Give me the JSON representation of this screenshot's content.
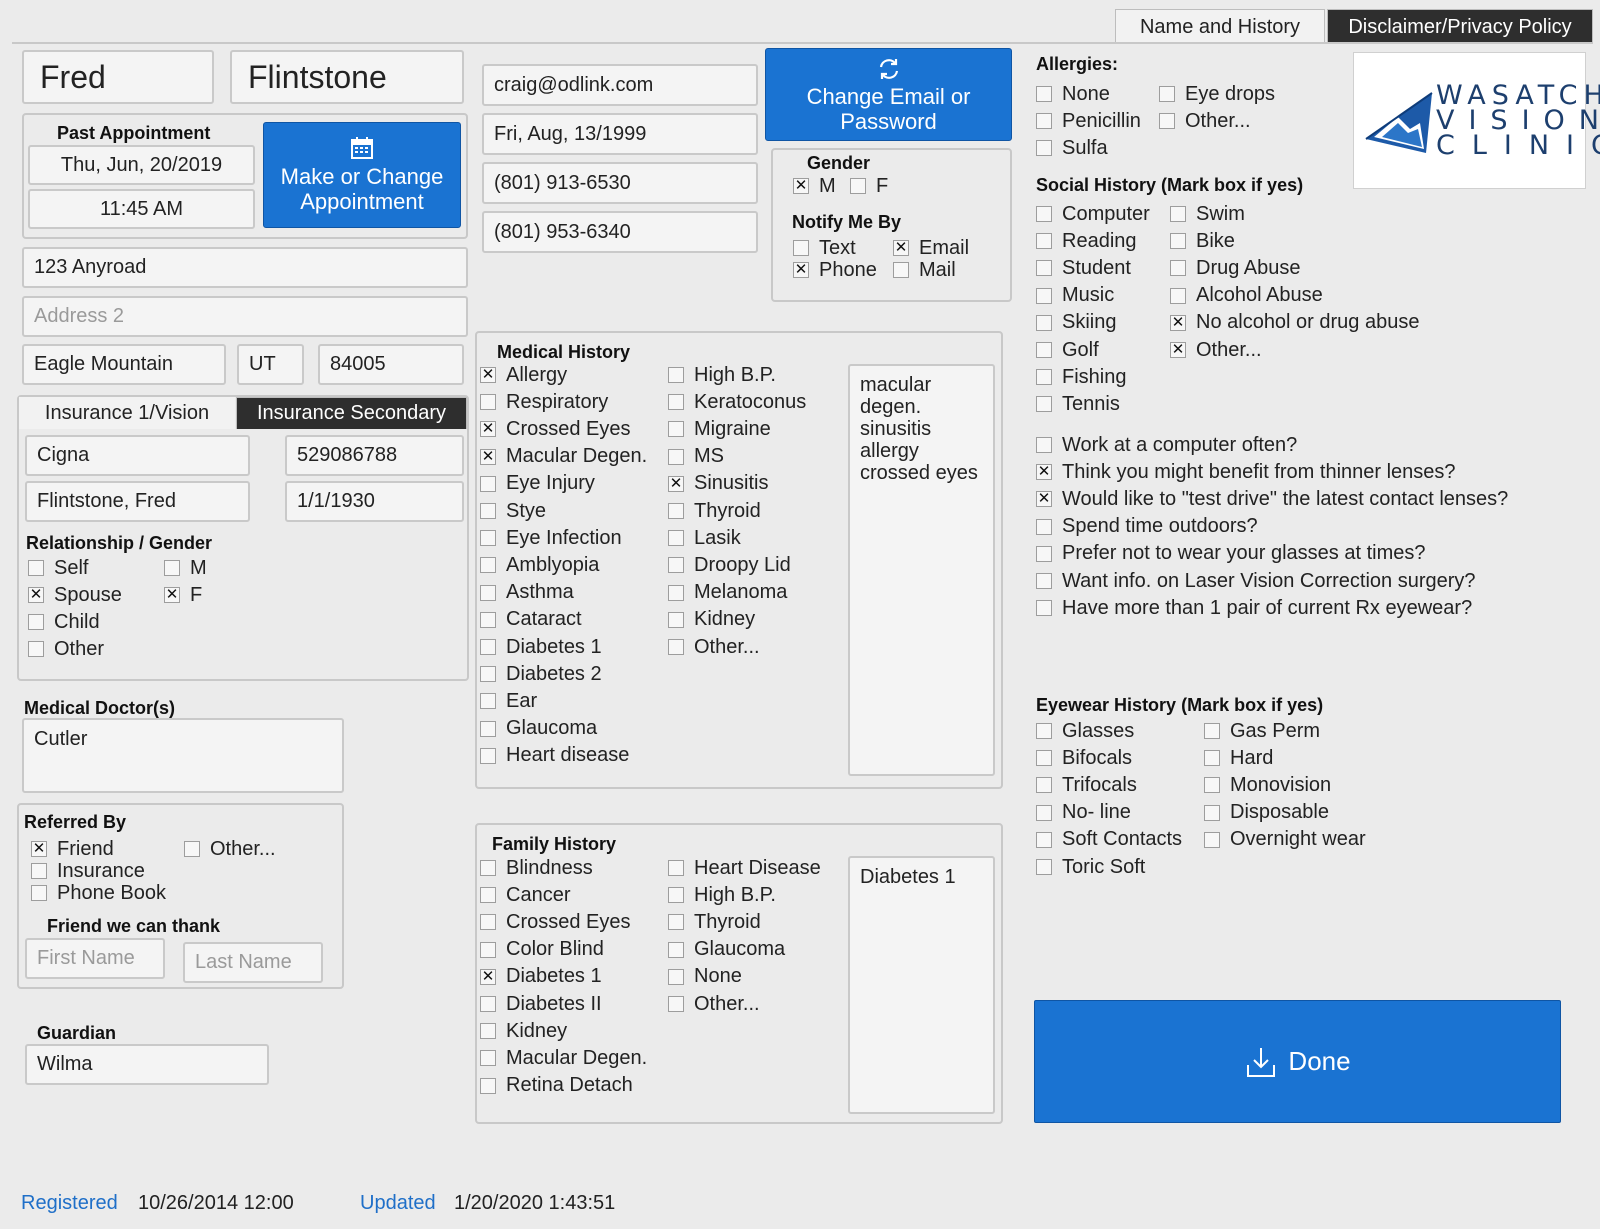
{
  "tabs": {
    "name_history": "Name and History",
    "disclaimer": "Disclaimer/Privacy Policy"
  },
  "patient": {
    "first_name": "Fred",
    "last_name": "Flintstone",
    "email": "craig@odlink.com",
    "dob": "Fri, Aug, 13/1999",
    "phone1": "(801) 913-6530",
    "phone2": "(801) 953-6340",
    "address1": "123 Anyroad",
    "address2_placeholder": "Address 2",
    "city": "Eagle Mountain",
    "state": "UT",
    "zip": "84005"
  },
  "appointment": {
    "title": "Past Appointment",
    "date": "Thu, Jun, 20/2019",
    "time": "11:45 AM",
    "button": "Make or Change Appointment",
    "icon": "calendar-icon"
  },
  "account_button": {
    "label": "Change Email or Password",
    "icon": "refresh-icon"
  },
  "gender": {
    "title": "Gender",
    "options": [
      {
        "label": "M",
        "checked": true
      },
      {
        "label": "F",
        "checked": false
      }
    ]
  },
  "notify": {
    "title": "Notify Me By",
    "options": [
      {
        "label": "Text",
        "checked": false
      },
      {
        "label": "Email",
        "checked": true
      },
      {
        "label": "Phone",
        "checked": true
      },
      {
        "label": "Mail",
        "checked": false
      }
    ]
  },
  "insurance": {
    "tab_primary": "Insurance 1/Vision",
    "tab_secondary": "Insurance Secondary",
    "carrier": "Cigna",
    "member_id": "529086788",
    "subscriber": "Flintstone, Fred",
    "sub_dob": "1/1/1930",
    "rel_title": "Relationship / Gender",
    "relationship": [
      {
        "label": "Self",
        "checked": false
      },
      {
        "label": "Spouse",
        "checked": true
      },
      {
        "label": "Child",
        "checked": false
      },
      {
        "label": "Other",
        "checked": false
      }
    ],
    "gender": [
      {
        "label": "M",
        "checked": false
      },
      {
        "label": "F",
        "checked": true
      }
    ]
  },
  "doctor": {
    "title": "Medical Doctor(s)",
    "value": "Cutler"
  },
  "referred": {
    "title": "Referred By",
    "options": [
      {
        "label": "Friend",
        "checked": true
      },
      {
        "label": "Other...",
        "checked": false
      },
      {
        "label": "Insurance",
        "checked": false
      },
      {
        "label": "Phone Book",
        "checked": false
      }
    ],
    "friend_title": "Friend we can thank",
    "first_placeholder": "First Name",
    "last_placeholder": "Last Name"
  },
  "guardian": {
    "title": "Guardian",
    "value": "Wilma"
  },
  "medical_history": {
    "title": "Medical History",
    "col1": [
      {
        "label": "Allergy",
        "checked": true
      },
      {
        "label": "Respiratory",
        "checked": false
      },
      {
        "label": "Crossed Eyes",
        "checked": true
      },
      {
        "label": "Macular Degen.",
        "checked": true
      },
      {
        "label": "Eye Injury",
        "checked": false
      },
      {
        "label": "Stye",
        "checked": false
      },
      {
        "label": "Eye Infection",
        "checked": false
      },
      {
        "label": "Amblyopia",
        "checked": false
      },
      {
        "label": "Asthma",
        "checked": false
      },
      {
        "label": "Cataract",
        "checked": false
      },
      {
        "label": "Diabetes 1",
        "checked": false
      },
      {
        "label": "Diabetes 2",
        "checked": false
      },
      {
        "label": "Ear",
        "checked": false
      },
      {
        "label": "Glaucoma",
        "checked": false
      },
      {
        "label": "Heart disease",
        "checked": false
      }
    ],
    "col2": [
      {
        "label": "High B.P.",
        "checked": false
      },
      {
        "label": "Keratoconus",
        "checked": false
      },
      {
        "label": "Migraine",
        "checked": false
      },
      {
        "label": "MS",
        "checked": false
      },
      {
        "label": "Sinusitis",
        "checked": true
      },
      {
        "label": "Thyroid",
        "checked": false
      },
      {
        "label": "Lasik",
        "checked": false
      },
      {
        "label": "Droopy Lid",
        "checked": false
      },
      {
        "label": "Melanoma",
        "checked": false
      },
      {
        "label": "Kidney",
        "checked": false
      },
      {
        "label": "Other...",
        "checked": false
      }
    ],
    "notes": "macular\ndegen.\nsinusitis\nallergy\ncrossed eyes"
  },
  "family_history": {
    "title": "Family History",
    "col1": [
      {
        "label": "Blindness",
        "checked": false
      },
      {
        "label": "Cancer",
        "checked": false
      },
      {
        "label": "Crossed Eyes",
        "checked": false
      },
      {
        "label": "Color Blind",
        "checked": false
      },
      {
        "label": "Diabetes 1",
        "checked": true
      },
      {
        "label": "Diabetes II",
        "checked": false
      },
      {
        "label": "Kidney",
        "checked": false
      },
      {
        "label": "Macular Degen.",
        "checked": false
      },
      {
        "label": "Retina Detach",
        "checked": false
      }
    ],
    "col2": [
      {
        "label": "Heart Disease",
        "checked": false
      },
      {
        "label": "High B.P.",
        "checked": false
      },
      {
        "label": "Thyroid",
        "checked": false
      },
      {
        "label": "Glaucoma",
        "checked": false
      },
      {
        "label": "None",
        "checked": false
      },
      {
        "label": "Other...",
        "checked": false
      }
    ],
    "notes": "Diabetes 1"
  },
  "allergies": {
    "title": "Allergies:",
    "col1": [
      {
        "label": "None",
        "checked": false
      },
      {
        "label": "Penicillin",
        "checked": false
      },
      {
        "label": "Sulfa",
        "checked": false
      }
    ],
    "col2": [
      {
        "label": "Eye drops",
        "checked": false
      },
      {
        "label": "Other...",
        "checked": false
      }
    ]
  },
  "logo": {
    "line1": "WASATCH",
    "line2": "VISION",
    "line3": "CLINIC"
  },
  "social_history": {
    "title": "Social History (Mark box if yes)",
    "col1": [
      {
        "label": "Computer",
        "checked": false
      },
      {
        "label": "Reading",
        "checked": false
      },
      {
        "label": "Student",
        "checked": false
      },
      {
        "label": "Music",
        "checked": false
      },
      {
        "label": "Skiing",
        "checked": false
      },
      {
        "label": "Golf",
        "checked": false
      },
      {
        "label": "Fishing",
        "checked": false
      },
      {
        "label": "Tennis",
        "checked": false
      }
    ],
    "col2": [
      {
        "label": "Swim",
        "checked": false
      },
      {
        "label": "Bike",
        "checked": false
      },
      {
        "label": "Drug Abuse",
        "checked": false
      },
      {
        "label": "Alcohol Abuse",
        "checked": false
      },
      {
        "label": "No alcohol or drug abuse",
        "checked": true
      },
      {
        "label": "Other...",
        "checked": true
      }
    ]
  },
  "questions": [
    {
      "label": "Work at a computer often?",
      "checked": false
    },
    {
      "label": "Think you might benefit from thinner lenses?",
      "checked": true
    },
    {
      "label": "Would like to \"test drive\" the latest contact lenses?",
      "checked": true
    },
    {
      "label": "Spend time outdoors?",
      "checked": false
    },
    {
      "label": "Prefer not to wear your glasses at times?",
      "checked": false
    },
    {
      "label": "Want info. on Laser Vision Correction surgery?",
      "checked": false
    },
    {
      "label": "Have more than 1 pair of current Rx eyewear?",
      "checked": false
    }
  ],
  "eyewear_history": {
    "title": "Eyewear History (Mark box if yes)",
    "col1": [
      {
        "label": "Glasses",
        "checked": false
      },
      {
        "label": "Bifocals",
        "checked": false
      },
      {
        "label": "Trifocals",
        "checked": false
      },
      {
        "label": "No- line",
        "checked": false
      },
      {
        "label": "Soft Contacts",
        "checked": false
      },
      {
        "label": "Toric Soft",
        "checked": false
      }
    ],
    "col2": [
      {
        "label": "Gas Perm",
        "checked": false
      },
      {
        "label": "Hard",
        "checked": false
      },
      {
        "label": "Monovision",
        "checked": false
      },
      {
        "label": "Disposable",
        "checked": false
      },
      {
        "label": "Overnight wear",
        "checked": false
      }
    ]
  },
  "done_button": {
    "label": "Done",
    "icon": "download-icon"
  },
  "footer": {
    "registered_label": "Registered",
    "registered_value": "10/26/2014 12:00",
    "updated_label": "Updated",
    "updated_value": "1/20/2020 1:43:51"
  },
  "colors": {
    "accent": "#1a73d2",
    "background": "#ebebeb",
    "dark_tab": "#2e2e2e",
    "link": "#1f6fc8"
  }
}
